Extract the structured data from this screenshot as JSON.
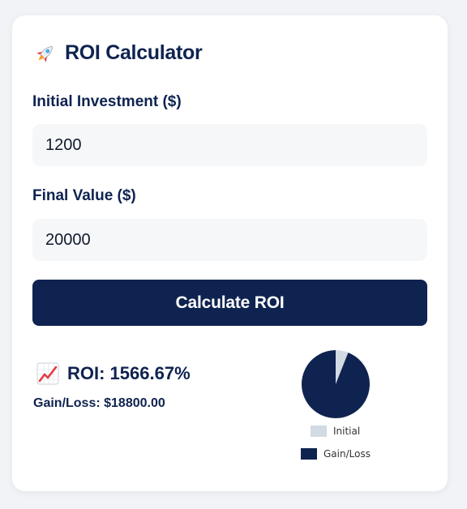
{
  "app": {
    "title": "ROI Calculator",
    "title_icon": "rocket-icon"
  },
  "form": {
    "investment_label": "Initial Investment ($)",
    "investment_value": "1200",
    "final_label": "Final Value ($)",
    "final_value": "20000",
    "calculate_label": "Calculate ROI"
  },
  "results": {
    "roi_icon": "chart-up-icon",
    "roi_text": "ROI: 1566.67%",
    "gain_text": "Gain/Loss: $18800.00"
  },
  "chart_data": {
    "type": "pie",
    "categories": [
      "Initial",
      "Gain/Loss"
    ],
    "values": [
      1200,
      18800
    ],
    "colors": [
      "#d2dae4",
      "#0f2350"
    ],
    "legend": "bottom"
  }
}
